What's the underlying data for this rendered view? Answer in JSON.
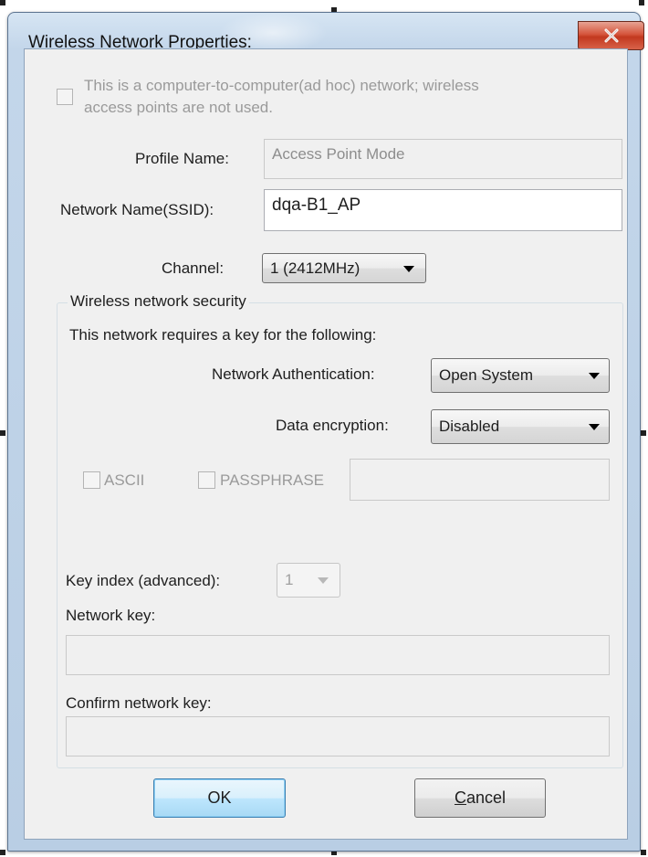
{
  "window": {
    "title": "Wireless Network Properties:",
    "close_icon": "close-x-icon"
  },
  "adhoc": {
    "checked": false,
    "enabled": false,
    "label_line1": "This is a computer-to-computer(ad hoc) network; wireless",
    "label_line2": "access points are not used."
  },
  "profile": {
    "label": "Profile Name:",
    "value": "Access Point Mode",
    "enabled": false
  },
  "ssid": {
    "label": "Network Name(SSID):",
    "value": "dqa-B1_AP"
  },
  "channel": {
    "label": "Channel:",
    "selected": "1 (2412MHz)"
  },
  "security": {
    "group_title": "Wireless network security",
    "description": "This network requires a key for the following:",
    "auth_label": "Network Authentication:",
    "auth_selected": "Open System",
    "encryption_label": "Data encryption:",
    "encryption_selected": "Disabled",
    "ascii_label": "ASCII",
    "passphrase_label": "PASSPHRASE",
    "passphrase_value": "",
    "key_index_label": "Key index (advanced):",
    "key_index_selected": "1",
    "network_key_label": "Network key:",
    "network_key_value": "",
    "confirm_key_label": "Confirm network key:",
    "confirm_key_value": ""
  },
  "buttons": {
    "ok_label": "OK",
    "cancel_mnemonic": "C",
    "cancel_rest": "ancel"
  },
  "colors": {
    "close_button": "#c2381f",
    "default_button_border": "#3c7fb1",
    "disabled_text": "#9a9a9a"
  }
}
